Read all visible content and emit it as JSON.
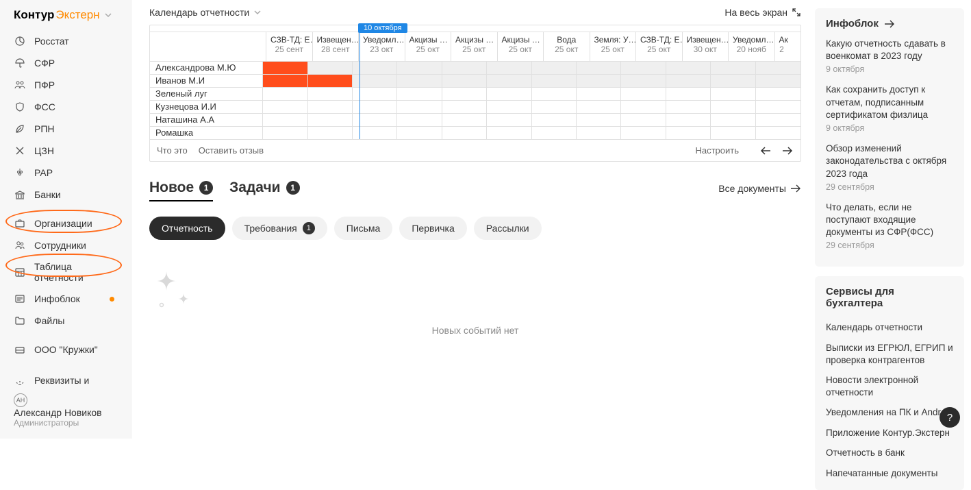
{
  "logo": {
    "part1": "Контур",
    "part2": "Экстерн"
  },
  "sidebar": {
    "items": [
      {
        "label": "Росстат"
      },
      {
        "label": "СФР"
      },
      {
        "label": "ПФР"
      },
      {
        "label": "ФСС"
      },
      {
        "label": "РПН"
      },
      {
        "label": "ЦЗН"
      },
      {
        "label": "РАР"
      },
      {
        "label": "Банки"
      }
    ],
    "org_label": "Организации",
    "employees_label": "Сотрудники",
    "table_label": "Таблица отчетности",
    "infoblock_label": "Инфоблок",
    "files_label": "Файлы",
    "org_name": "ООО \"Кружки\"",
    "settings_label": "Реквизиты и настройки",
    "user_name": "Александр Новиков",
    "user_role": "Администраторы",
    "user_initials": "АН"
  },
  "calendar": {
    "title": "Календарь отчетности",
    "fullscreen": "На весь экран",
    "date_marker": "10 октября",
    "columns": [
      {
        "t": "СЗВ-ТД: Е…",
        "d": "25 сент"
      },
      {
        "t": "Извещен…",
        "d": "28 сент"
      },
      {
        "t": "Уведомл…",
        "d": "23 окт"
      },
      {
        "t": "Акцизы …",
        "d": "25 окт"
      },
      {
        "t": "Акцизы …",
        "d": "25 окт"
      },
      {
        "t": "Акцизы …",
        "d": "25 окт"
      },
      {
        "t": "Вода",
        "d": "25 окт"
      },
      {
        "t": "Земля: У…",
        "d": "25 окт"
      },
      {
        "t": "СЗВ-ТД: Е…",
        "d": "25 окт"
      },
      {
        "t": "Извещен…",
        "d": "30 окт"
      },
      {
        "t": "Уведомл…",
        "d": "20 нояб"
      },
      {
        "t": "Ак",
        "d": "2"
      }
    ],
    "rows": [
      "Александрова М.Ю",
      "Иванов М.И",
      "Зеленый луг",
      "Кузнецова И.И",
      "Наташина А.А",
      "Ромашка"
    ],
    "what_is": "Что это",
    "feedback": "Оставить отзыв",
    "configure": "Настроить"
  },
  "tabs": {
    "new_label": "Новое",
    "new_count": "1",
    "tasks_label": "Задачи",
    "tasks_count": "1",
    "all_docs": "Все документы"
  },
  "filters": {
    "reporting": "Отчетность",
    "demands": "Требования",
    "demands_count": "1",
    "letters": "Письма",
    "primary": "Первичка",
    "mailings": "Рассылки"
  },
  "empty_text": "Новых событий нет",
  "infoblock": {
    "title": "Инфоблок",
    "items": [
      {
        "t": "Какую отчетность сдавать в военкомат в 2023 году",
        "d": "9 октября"
      },
      {
        "t": "Как сохранить доступ к отчетам, подписанным сертификатом физлица",
        "d": "9 октября"
      },
      {
        "t": "Обзор изменений законодательства с октября 2023 года",
        "d": "29 сентября"
      },
      {
        "t": "Что делать, если не поступают входящие документы из СФР(ФСС)",
        "d": "29 сентября"
      }
    ]
  },
  "services": {
    "title": "Сервисы для бухгалтера",
    "items": [
      "Календарь отчетности",
      "Выписки из ЕГРЮЛ, ЕГРИП и проверка контрагентов",
      "Новости электронной отчетности",
      "Уведомления на ПК и Android",
      "Приложение Контур.Экстерн",
      "Отчетность в банк",
      "Напечатанные документы"
    ]
  }
}
